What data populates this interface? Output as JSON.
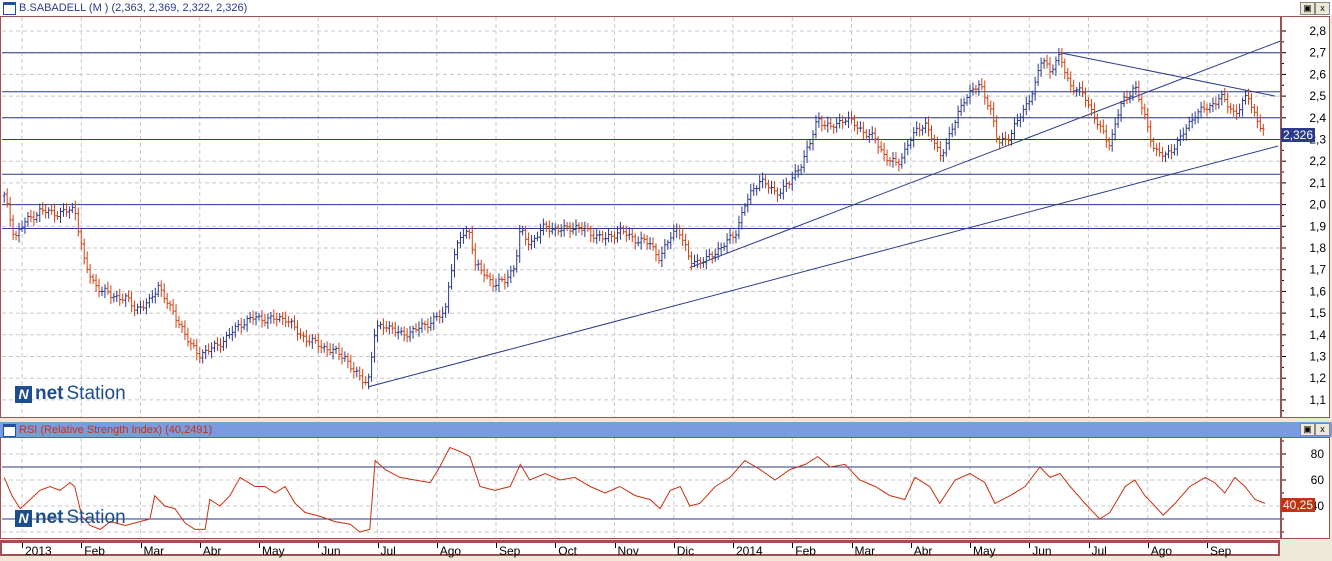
{
  "window": {
    "title": "B.SABADELL (M ) (2,363, 2,369, 2,322, 2,326)",
    "rsi_title": "RSI (Relative Strength Index) (40,2491)",
    "minimize_icon": "restore-icon",
    "close_icon": "close-icon",
    "close_label": "x"
  },
  "logo": {
    "net": "net",
    "station": "Station",
    "mark": "N"
  },
  "colors": {
    "up": "#2a3a8c",
    "down": "#d04010",
    "line": "#2a3a8c",
    "rsi": "#c83010",
    "border": "#a05050"
  },
  "chart_data": [
    {
      "type": "ohlc",
      "title": "B.SABADELL (M )",
      "last": {
        "open": "2,363",
        "high": "2,369",
        "low": "2,322",
        "close": "2,326"
      },
      "last_label": "2,326",
      "x_unit": "months since Jan 2013",
      "ylim": [
        1.05,
        2.85
      ],
      "yticks": [
        "2,8",
        "2,7",
        "2,6",
        "2,5",
        "2,4",
        "2,3",
        "2,2",
        "2,1",
        "2,0",
        "1,9",
        "1,8",
        "1,7",
        "1,6",
        "1,5",
        "1,4",
        "1,3",
        "1,2",
        "1,1"
      ],
      "ytick_values": [
        2.8,
        2.7,
        2.6,
        2.5,
        2.4,
        2.3,
        2.2,
        2.1,
        2.0,
        1.9,
        1.8,
        1.7,
        1.6,
        1.5,
        1.4,
        1.3,
        1.2,
        1.1
      ],
      "grid": true,
      "close": [
        [
          -0.3,
          2.04
        ],
        [
          -0.12,
          1.85
        ],
        [
          0.05,
          1.92
        ],
        [
          0.3,
          1.97
        ],
        [
          0.64,
          1.96
        ],
        [
          0.89,
          1.98
        ],
        [
          0.98,
          1.85
        ],
        [
          1.06,
          1.72
        ],
        [
          1.23,
          1.63
        ],
        [
          1.49,
          1.58
        ],
        [
          1.74,
          1.57
        ],
        [
          1.91,
          1.52
        ],
        [
          2.16,
          1.55
        ],
        [
          2.3,
          1.63
        ],
        [
          2.5,
          1.52
        ],
        [
          2.67,
          1.45
        ],
        [
          2.84,
          1.35
        ],
        [
          3.0,
          1.31
        ],
        [
          3.17,
          1.33
        ],
        [
          3.43,
          1.38
        ],
        [
          3.68,
          1.45
        ],
        [
          3.93,
          1.48
        ],
        [
          4.19,
          1.47
        ],
        [
          4.44,
          1.48
        ],
        [
          4.69,
          1.4
        ],
        [
          4.95,
          1.36
        ],
        [
          5.2,
          1.33
        ],
        [
          5.45,
          1.3
        ],
        [
          5.62,
          1.22
        ],
        [
          5.84,
          1.18
        ],
        [
          5.96,
          1.42
        ],
        [
          6.13,
          1.45
        ],
        [
          6.38,
          1.4
        ],
        [
          6.63,
          1.42
        ],
        [
          6.89,
          1.46
        ],
        [
          7.14,
          1.5
        ],
        [
          7.22,
          1.68
        ],
        [
          7.39,
          1.85
        ],
        [
          7.56,
          1.88
        ],
        [
          7.65,
          1.72
        ],
        [
          7.81,
          1.68
        ],
        [
          7.98,
          1.63
        ],
        [
          8.15,
          1.65
        ],
        [
          8.32,
          1.72
        ],
        [
          8.41,
          1.88
        ],
        [
          8.57,
          1.82
        ],
        [
          8.83,
          1.9
        ],
        [
          9.08,
          1.88
        ],
        [
          9.33,
          1.9
        ],
        [
          9.59,
          1.87
        ],
        [
          9.84,
          1.84
        ],
        [
          10.09,
          1.88
        ],
        [
          10.35,
          1.84
        ],
        [
          10.6,
          1.82
        ],
        [
          10.77,
          1.75
        ],
        [
          10.94,
          1.85
        ],
        [
          11.07,
          1.9
        ],
        [
          11.27,
          1.74
        ],
        [
          11.53,
          1.74
        ],
        [
          11.78,
          1.8
        ],
        [
          12.03,
          1.86
        ],
        [
          12.2,
          2.0
        ],
        [
          12.46,
          2.12
        ],
        [
          12.71,
          2.05
        ],
        [
          12.96,
          2.1
        ],
        [
          13.13,
          2.18
        ],
        [
          13.3,
          2.28
        ],
        [
          13.43,
          2.4
        ],
        [
          13.64,
          2.35
        ],
        [
          13.89,
          2.4
        ],
        [
          14.14,
          2.35
        ],
        [
          14.4,
          2.3
        ],
        [
          14.57,
          2.22
        ],
        [
          14.77,
          2.18
        ],
        [
          14.99,
          2.3
        ],
        [
          15.24,
          2.38
        ],
        [
          15.49,
          2.22
        ],
        [
          15.75,
          2.38
        ],
        [
          15.92,
          2.5
        ],
        [
          16.17,
          2.55
        ],
        [
          16.34,
          2.45
        ],
        [
          16.47,
          2.28
        ],
        [
          16.68,
          2.32
        ],
        [
          16.93,
          2.45
        ],
        [
          17.1,
          2.55
        ],
        [
          17.22,
          2.68
        ],
        [
          17.35,
          2.62
        ],
        [
          17.52,
          2.68
        ],
        [
          17.69,
          2.55
        ],
        [
          17.94,
          2.5
        ],
        [
          18.19,
          2.35
        ],
        [
          18.36,
          2.28
        ],
        [
          18.53,
          2.45
        ],
        [
          18.78,
          2.55
        ],
        [
          18.95,
          2.4
        ],
        [
          19.12,
          2.25
        ],
        [
          19.29,
          2.22
        ],
        [
          19.54,
          2.3
        ],
        [
          19.8,
          2.42
        ],
        [
          20.05,
          2.45
        ],
        [
          20.22,
          2.5
        ],
        [
          20.47,
          2.42
        ],
        [
          20.69,
          2.5
        ],
        [
          20.86,
          2.38
        ],
        [
          20.98,
          2.33
        ]
      ],
      "horizontal_lines": [
        2.7,
        2.52,
        2.4,
        2.3,
        2.14,
        2.0,
        1.89
      ],
      "trendlines": [
        {
          "from": [
            5.84,
            1.16
          ],
          "to": [
            21.2,
            2.27
          ]
        },
        {
          "from": [
            11.27,
            1.71
          ],
          "to": [
            21.87,
            2.82
          ]
        },
        {
          "from": [
            17.52,
            2.7
          ],
          "to": [
            21.15,
            2.5
          ]
        }
      ]
    },
    {
      "type": "line",
      "title": "RSI (Relative Strength Index)",
      "last_label": "40,25",
      "ylim": [
        16,
        92
      ],
      "yticks": [
        "80",
        "60",
        "40"
      ],
      "ytick_values": [
        80,
        60,
        40
      ],
      "horizontal_lines": [
        70,
        30
      ],
      "values": [
        [
          -0.3,
          62
        ],
        [
          -0.17,
          48
        ],
        [
          -0.03,
          38
        ],
        [
          0.14,
          45
        ],
        [
          0.3,
          52
        ],
        [
          0.47,
          55
        ],
        [
          0.64,
          52
        ],
        [
          0.81,
          58
        ],
        [
          0.89,
          55
        ],
        [
          1.01,
          32
        ],
        [
          1.15,
          25
        ],
        [
          1.32,
          22
        ],
        [
          1.49,
          28
        ],
        [
          1.74,
          25
        ],
        [
          1.99,
          28
        ],
        [
          2.16,
          30
        ],
        [
          2.24,
          48
        ],
        [
          2.41,
          40
        ],
        [
          2.58,
          38
        ],
        [
          2.75,
          27
        ],
        [
          2.92,
          22
        ],
        [
          3.09,
          22
        ],
        [
          3.17,
          45
        ],
        [
          3.34,
          40
        ],
        [
          3.51,
          48
        ],
        [
          3.68,
          62
        ],
        [
          3.93,
          55
        ],
        [
          4.1,
          55
        ],
        [
          4.27,
          50
        ],
        [
          4.44,
          55
        ],
        [
          4.61,
          42
        ],
        [
          4.78,
          35
        ],
        [
          5.03,
          32
        ],
        [
          5.28,
          28
        ],
        [
          5.54,
          26
        ],
        [
          5.7,
          20
        ],
        [
          5.87,
          22
        ],
        [
          5.96,
          75
        ],
        [
          6.13,
          68
        ],
        [
          6.38,
          62
        ],
        [
          6.63,
          60
        ],
        [
          6.89,
          58
        ],
        [
          7.05,
          70
        ],
        [
          7.22,
          85
        ],
        [
          7.39,
          82
        ],
        [
          7.56,
          78
        ],
        [
          7.73,
          55
        ],
        [
          7.98,
          52
        ],
        [
          8.24,
          55
        ],
        [
          8.41,
          72
        ],
        [
          8.57,
          60
        ],
        [
          8.83,
          65
        ],
        [
          9.08,
          60
        ],
        [
          9.33,
          62
        ],
        [
          9.59,
          55
        ],
        [
          9.84,
          50
        ],
        [
          10.09,
          55
        ],
        [
          10.35,
          48
        ],
        [
          10.6,
          45
        ],
        [
          10.77,
          38
        ],
        [
          10.94,
          52
        ],
        [
          11.11,
          55
        ],
        [
          11.27,
          40
        ],
        [
          11.44,
          42
        ],
        [
          11.7,
          55
        ],
        [
          11.95,
          62
        ],
        [
          12.2,
          75
        ],
        [
          12.46,
          68
        ],
        [
          12.71,
          60
        ],
        [
          12.96,
          68
        ],
        [
          13.22,
          72
        ],
        [
          13.43,
          78
        ],
        [
          13.64,
          70
        ],
        [
          13.89,
          72
        ],
        [
          14.14,
          60
        ],
        [
          14.4,
          55
        ],
        [
          14.65,
          48
        ],
        [
          14.9,
          45
        ],
        [
          15.07,
          62
        ],
        [
          15.32,
          55
        ],
        [
          15.49,
          42
        ],
        [
          15.75,
          60
        ],
        [
          16.0,
          65
        ],
        [
          16.25,
          58
        ],
        [
          16.42,
          42
        ],
        [
          16.68,
          48
        ],
        [
          16.93,
          55
        ],
        [
          17.18,
          70
        ],
        [
          17.35,
          62
        ],
        [
          17.52,
          65
        ],
        [
          17.69,
          55
        ],
        [
          17.94,
          42
        ],
        [
          18.19,
          30
        ],
        [
          18.36,
          35
        ],
        [
          18.62,
          55
        ],
        [
          18.78,
          60
        ],
        [
          18.95,
          48
        ],
        [
          19.12,
          40
        ],
        [
          19.26,
          33
        ],
        [
          19.46,
          42
        ],
        [
          19.71,
          55
        ],
        [
          19.97,
          62
        ],
        [
          20.13,
          58
        ],
        [
          20.3,
          50
        ],
        [
          20.47,
          62
        ],
        [
          20.64,
          55
        ],
        [
          20.81,
          45
        ],
        [
          20.98,
          42
        ]
      ]
    }
  ],
  "x_axis": {
    "labels": [
      "2013",
      "Feb",
      "Mar",
      "Abr",
      "May",
      "Jun",
      "Jul",
      "Ago",
      "Sep",
      "Oct",
      "Nov",
      "Dic",
      "2014",
      "Feb",
      "Mar",
      "Abr",
      "May",
      "Jun",
      "Jul",
      "Ago",
      "Sep"
    ],
    "months": [
      0,
      1,
      2,
      3,
      4,
      5,
      6,
      7,
      8,
      9,
      10,
      11,
      12,
      13,
      14,
      15,
      16,
      17,
      18,
      19,
      20
    ]
  }
}
